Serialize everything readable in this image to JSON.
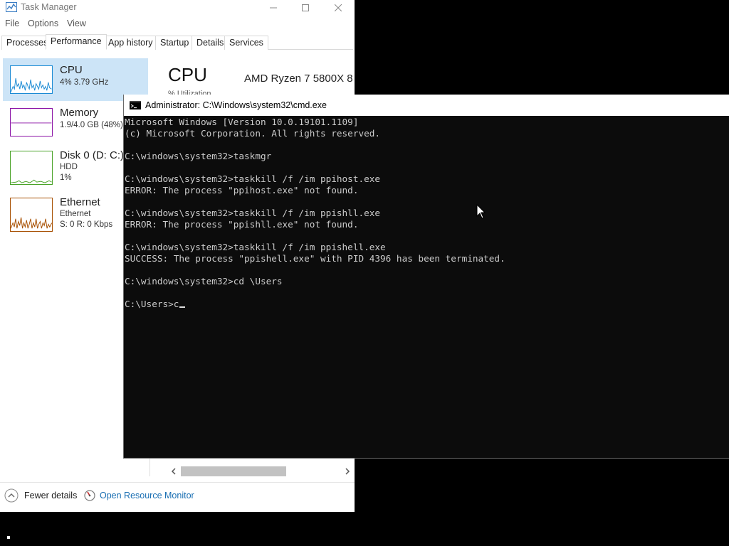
{
  "task_manager": {
    "title": "Task Manager",
    "menu": [
      "File",
      "Options",
      "View"
    ],
    "tabs": [
      "Processes",
      "Performance",
      "App history",
      "Startup",
      "Details",
      "Services"
    ],
    "active_tab": "Performance",
    "perf_items": [
      {
        "name": "CPU",
        "sub1": "4%  3.79 GHz",
        "sub2": "",
        "graph_color": "#1a8ad4"
      },
      {
        "name": "Memory",
        "sub1": "1.9/4.0 GB (48%)",
        "sub2": "",
        "graph_color": "#8b13a6"
      },
      {
        "name": "Disk 0 (D: C:)",
        "sub1": "HDD",
        "sub2": "1%",
        "graph_color": "#4aa328"
      },
      {
        "name": "Ethernet",
        "sub1": "Ethernet",
        "sub2": "S: 0  R: 0 Kbps",
        "graph_color": "#a74f01"
      }
    ],
    "selected_item": "CPU",
    "detail_title": "CPU",
    "cpu_model": "AMD Ryzen 7 5800X 8",
    "util_fragment": "% Utilization",
    "footer": {
      "fewer_details": "Fewer details",
      "open_resource_monitor": "Open Resource Monitor"
    }
  },
  "cmd": {
    "title": "Administrator: C:\\Windows\\system32\\cmd.exe",
    "lines": [
      "Microsoft Windows [Version 10.0.19101.1109]",
      "(c) Microsoft Corporation. All rights reserved.",
      "",
      "C:\\windows\\system32>taskmgr",
      "",
      "C:\\windows\\system32>taskkill /f /im ppihost.exe",
      "ERROR: The process \"ppihost.exe\" not found.",
      "",
      "C:\\windows\\system32>taskkill /f /im ppishll.exe",
      "ERROR: The process \"ppishll.exe\" not found.",
      "",
      "C:\\windows\\system32>taskkill /f /im ppishell.exe",
      "SUCCESS: The process \"ppishell.exe\" with PID 4396 has been terminated.",
      "",
      "C:\\windows\\system32>cd \\Users",
      "",
      "C:\\Users>c"
    ]
  },
  "colors": {
    "accent": "#1a6fb3",
    "selection": "#cce4f7",
    "console_bg": "#0c0c0c",
    "console_text": "#cccccc"
  }
}
